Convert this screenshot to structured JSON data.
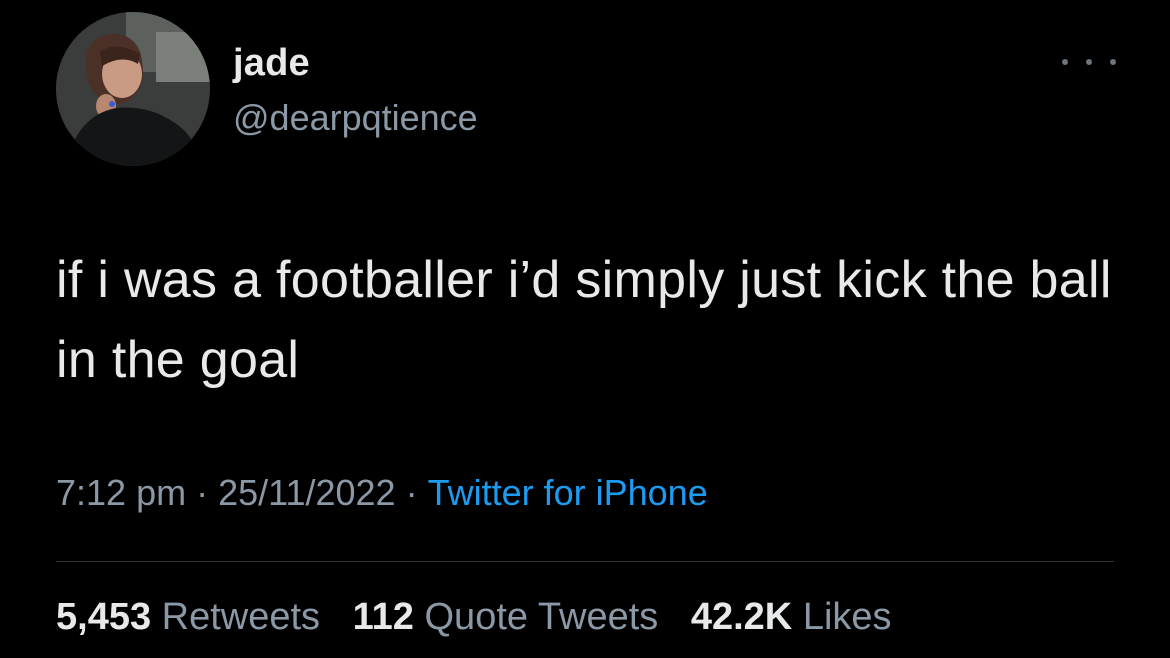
{
  "user": {
    "display_name": "jade",
    "handle": "@dearpqtience",
    "avatar_icon": "profile-photo"
  },
  "tweet": {
    "text": "if i was a footballer i’d simply just kick the ball in the goal"
  },
  "meta": {
    "time": "7:12 pm",
    "date": "25/11/2022",
    "separator": "·",
    "source": "Twitter for iPhone"
  },
  "stats": {
    "retweets": {
      "count": "5,453",
      "label": "Retweets"
    },
    "quotes": {
      "count": "112",
      "label": "Quote Tweets"
    },
    "likes": {
      "count": "42.2K",
      "label": "Likes"
    }
  },
  "colors": {
    "background": "#000000",
    "text_primary": "#e7e9ea",
    "text_secondary": "#8b98a5",
    "link": "#1d9bf0",
    "divider": "#2f3336"
  }
}
